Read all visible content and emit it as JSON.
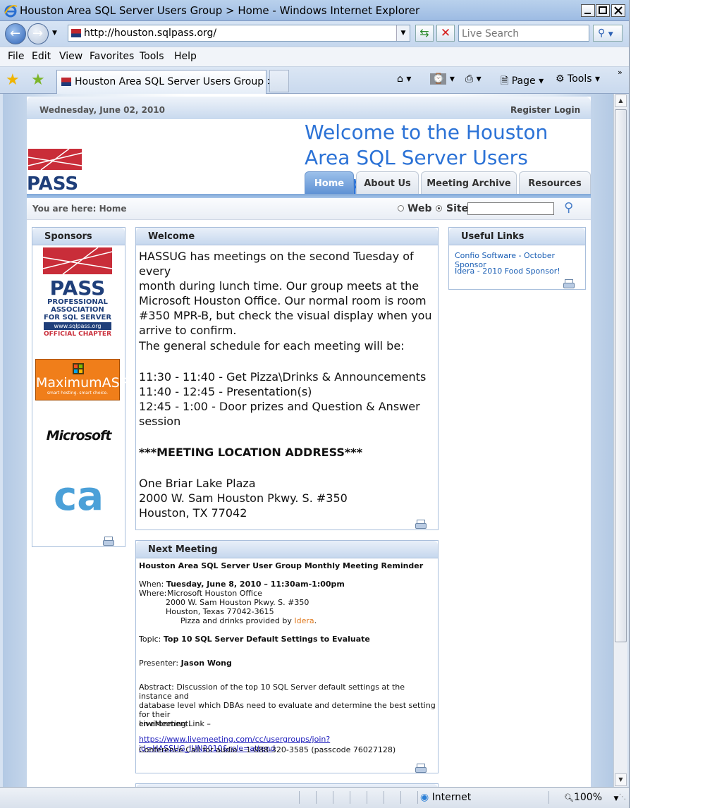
{
  "window": {
    "title": "Houston Area SQL Server Users Group > Home - Windows Internet Explorer"
  },
  "address": {
    "url": "http://houston.sqlpass.org/",
    "search_placeholder": "Live Search"
  },
  "menu": [
    "File",
    "Edit",
    "View",
    "Favorites",
    "Tools",
    "Help"
  ],
  "tab": {
    "label": "Houston Area SQL Server Users Group > ..."
  },
  "toolbar": {
    "page": "Page",
    "tools": "Tools"
  },
  "page": {
    "date": "Wednesday, June 02, 2010",
    "register": "Register",
    "login": "Login",
    "welcome_line1": "Welcome to the Houston",
    "welcome_line2": "Area SQL Server Users Group",
    "logo_text": "PASS",
    "nav": [
      "Home",
      "About Us",
      "Meeting Archive",
      "Resources"
    ],
    "breadcrumb": "You are here: Home",
    "search_web": "Web",
    "search_site": "Site"
  },
  "sponsors": {
    "title": "Sponsors",
    "pass_lines": [
      "PASS",
      "PROFESSIONAL",
      "ASSOCIATION",
      "FOR SQL SERVER",
      "www.sqlpass.org",
      "OFFICIAL CHAPTER"
    ],
    "maximum_asp": "MaximumASP",
    "maximum_tagline": "smart hosting. smart choice.",
    "microsoft": "Microsoft",
    "ca": "ca"
  },
  "welcome": {
    "title": "Welcome",
    "p1": [
      "HASSUG has meetings on the second Tuesday of every",
      "month during lunch time.  Our group meets at the",
      "Microsoft Houston Office. Our normal room is room",
      "#350 MPR-B, but check the visual display when you",
      "arrive to confirm."
    ],
    "p2": "The general schedule for each meeting will be:",
    "schedule": [
      "11:30 - 11:40 - Get Pizza\\Drinks & Announcements",
      "11:40 - 12:45 - Presentation(s)",
      "12:45 - 1:00 - Door prizes and Question & Answer",
      "session"
    ],
    "location_heading": "***MEETING LOCATION ADDRESS***",
    "address": [
      "One Briar Lake Plaza",
      "2000 W. Sam Houston Pkwy. S. #350",
      "Houston, TX 77042"
    ]
  },
  "next_meeting": {
    "title": "Next Meeting",
    "heading": "Houston Area SQL Server User Group Monthly Meeting Reminder",
    "when_label": "When:",
    "when_value": "Tuesday, June 8, 2010 – 11:30am-1:00pm",
    "where_label": "Where:",
    "where_lines": [
      "Microsoft Houston Office",
      "2000 W. Sam Houston Pkwy. S. #350",
      "Houston, Texas 77042-3615"
    ],
    "pizza_pre": "Pizza and drinks provided by ",
    "pizza_link": "Idera",
    "pizza_post": ".",
    "topic_label": "Topic:",
    "topic_value": "Top 10 SQL Server Default Settings to Evaluate",
    "presenter_label": "Presenter:",
    "presenter_value": "Jason Wong",
    "abstract": [
      "Abstract: Discussion of the top 10 SQL Server default settings at the instance and",
      "database level which DBAs need to evaluate and determine the best setting for their",
      "environment."
    ],
    "livemeeting_label": "LiveMeeting Link –",
    "livemeeting_url": "https://www.livemeeting.com/cc/usergroups/join?id=HASSUG_JUN2010&role=attend",
    "conference": "Conference Call for audio – 1-888-320-3585 (passcode 76027128)"
  },
  "useful_links": {
    "title": "Useful Links",
    "items": [
      "Confio Software - October Sponsor",
      "Idera - 2010 Food Sponsor!"
    ]
  },
  "status": {
    "zone": "Internet",
    "zoom": "100%"
  }
}
